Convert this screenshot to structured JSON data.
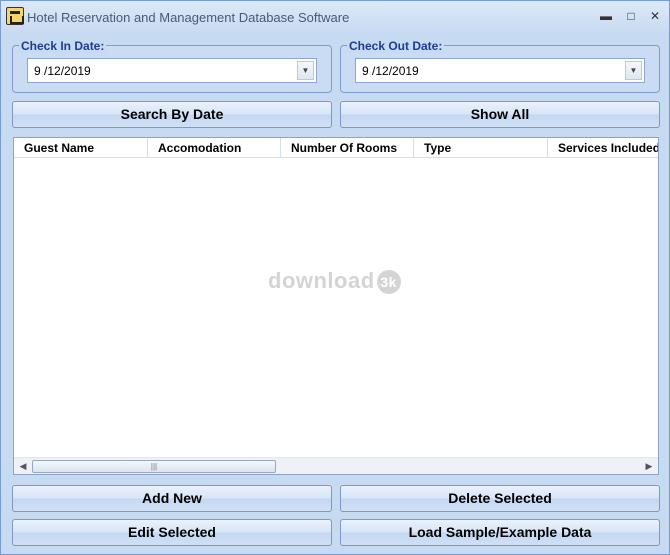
{
  "window": {
    "title": "Hotel Reservation and Management Database Software",
    "controls": {
      "minimize": "▬",
      "maximize": "□",
      "close": "✕"
    }
  },
  "check_in": {
    "label": "Check In Date:",
    "value": "9 /12/2019"
  },
  "check_out": {
    "label": "Check Out Date:",
    "value": "9 /12/2019"
  },
  "buttons": {
    "search_by_date": "Search By Date",
    "show_all": "Show All",
    "add_new": "Add New",
    "delete_selected": "Delete Selected",
    "edit_selected": "Edit Selected",
    "load_sample": "Load Sample/Example Data"
  },
  "grid": {
    "columns": [
      "Guest Name",
      "Accomodation",
      "Number Of Rooms",
      "Type",
      "Services Included"
    ],
    "rows": []
  },
  "watermark": {
    "text": "download",
    "badge": "3k"
  },
  "icons": {
    "app": "hotel-app-icon",
    "dropdown": "chevron-down-icon",
    "scroll_left": "arrow-left-icon",
    "scroll_right": "arrow-right-icon"
  },
  "colors": {
    "window_bg": "#c6daf2",
    "group_label": "#1f3d8c",
    "grid_bg": "#ffffff"
  }
}
